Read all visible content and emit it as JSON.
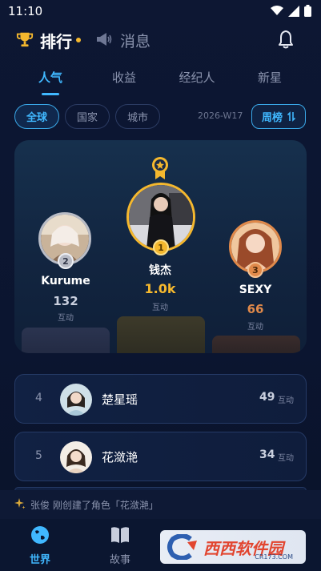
{
  "status_bar": {
    "time": "11:10"
  },
  "header": {
    "active_title": "排行",
    "inactive_title": "消息"
  },
  "tabs": [
    {
      "label": "人气",
      "active": true
    },
    {
      "label": "收益",
      "active": false
    },
    {
      "label": "经纪人",
      "active": false
    },
    {
      "label": "新星",
      "active": false
    }
  ],
  "filters": {
    "scopes": [
      {
        "label": "全球",
        "active": true
      },
      {
        "label": "国家",
        "active": false
      },
      {
        "label": "城市",
        "active": false
      }
    ],
    "week": "2026-W17",
    "period_label": "周榜"
  },
  "podium": [
    {
      "rank": "2",
      "name": "Kurume",
      "score": "132",
      "unit": "互动"
    },
    {
      "rank": "1",
      "name": "钱杰",
      "score": "1.0k",
      "unit": "互动"
    },
    {
      "rank": "3",
      "name": "SEXY",
      "score": "66",
      "unit": "互动"
    }
  ],
  "list": [
    {
      "rank": "4",
      "name": "楚星瑶",
      "score": "49",
      "unit": "互动"
    },
    {
      "rank": "5",
      "name": "花潋滟",
      "score": "34",
      "unit": "互动"
    }
  ],
  "activity": {
    "text": "张俊 刚创建了角色「花潋滟」"
  },
  "bottom_nav": [
    {
      "label": "世界",
      "active": true
    },
    {
      "label": "故事",
      "active": false
    }
  ],
  "watermark": {
    "brand": "西西软件园",
    "url": "CR173.COM"
  },
  "colors": {
    "accent": "#40b8ff",
    "gold": "#f5b82e",
    "bronze": "#e0894a",
    "silver": "#b9bcc6"
  }
}
